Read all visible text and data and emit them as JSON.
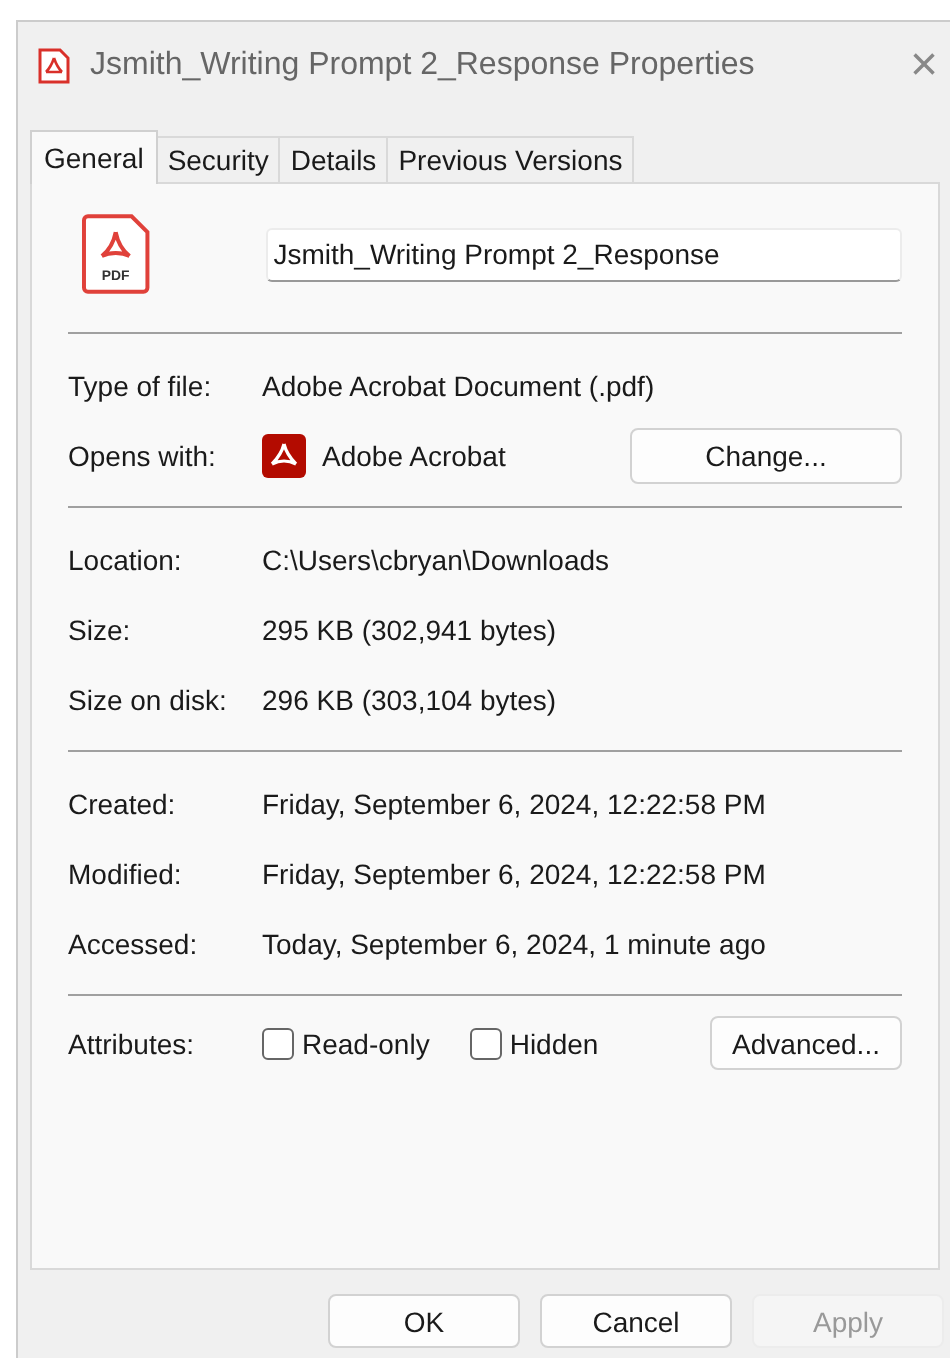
{
  "window": {
    "title": "Jsmith_Writing Prompt 2_Response Properties",
    "close": "×"
  },
  "tabs": [
    {
      "label": "General",
      "selected": true
    },
    {
      "label": "Security",
      "selected": false
    },
    {
      "label": "Details",
      "selected": false
    },
    {
      "label": "Previous Versions",
      "selected": false
    }
  ],
  "file_name": "Jsmith_Writing Prompt 2_Response",
  "file_icon_label": "PDF",
  "sections": [
    [
      {
        "label": "Type of file:",
        "value": "Adobe Acrobat Document (.pdf)"
      },
      {
        "label": "Opens with:",
        "value": "Adobe Acrobat",
        "kind": "app",
        "button": "Change..."
      }
    ],
    [
      {
        "label": "Location:",
        "value": "C:\\Users\\cbryan\\Downloads"
      },
      {
        "label": "Size:",
        "value": "295 KB (302,941 bytes)"
      },
      {
        "label": "Size on disk:",
        "value": "296 KB (303,104 bytes)"
      }
    ],
    [
      {
        "label": "Created:",
        "value": "Friday, September 6, 2024, 12:22:58 PM"
      },
      {
        "label": "Modified:",
        "value": "Friday, September 6, 2024, 12:22:58 PM"
      },
      {
        "label": "Accessed:",
        "value": "Today, September 6, 2024, 1 minute ago"
      }
    ]
  ],
  "attributes": {
    "label": "Attributes:",
    "checkboxes": [
      {
        "label": "Read-only",
        "checked": false
      },
      {
        "label": "Hidden",
        "checked": false
      }
    ],
    "button": "Advanced..."
  },
  "buttons": [
    {
      "label": "OK",
      "disabled": false
    },
    {
      "label": "Cancel",
      "disabled": false
    },
    {
      "label": "Apply",
      "disabled": true
    }
  ]
}
